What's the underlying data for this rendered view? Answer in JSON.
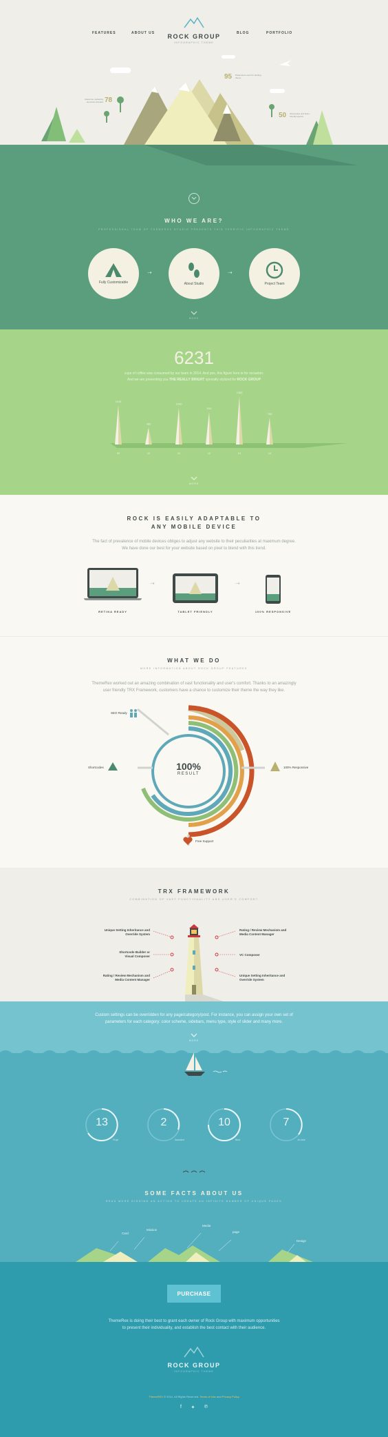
{
  "brand": {
    "name": "ROCK GROUP",
    "tagline": "INFOGRAPHIC THEME"
  },
  "nav": {
    "items": [
      "FEATURES",
      "ABOUT US",
      "BLOG",
      "PORTFOLIO"
    ]
  },
  "hero": {
    "stats": [
      {
        "value": "95",
        "text": "Parameters used for landing theme"
      },
      {
        "value": "78",
        "text": "Awesome marketing elements included"
      },
      {
        "value": "50",
        "text": "Shortcodes and brain-friendly layouts"
      }
    ]
  },
  "who": {
    "title": "WHO WE ARE?",
    "subtitle": "PROFESSIONAL TEAM OF THEMEREX STUDIO PRESENTS THIS TERRIFIC INFOGRAPHIC THEME",
    "items": [
      {
        "label": "Fully Customizable",
        "icon": "tent-icon"
      },
      {
        "label": "About Studio",
        "icon": "footprints-icon"
      },
      {
        "label": "Project Team",
        "icon": "clock-icon"
      }
    ],
    "more": "MORE"
  },
  "coffee": {
    "number": "6231",
    "text1": "cups of coffee was consumed by our team in 2014. And yes, this figure here is for occasion.",
    "text2_pre": "And we are presenting you",
    "text2_b1": "THE REALLY BRIGHT",
    "text2_mid": "specially stylized for",
    "text2_b2": "ROCK GROUP",
    "more": "MORE"
  },
  "chart_data": {
    "type": "bar",
    "categories": [
      "09",
      "10",
      "11",
      "12",
      "13",
      "14"
    ],
    "values": [
      1105,
      480,
      1040,
      910,
      1360,
      760
    ],
    "value_labels": [
      "1105",
      "480",
      "1040",
      "910",
      "1360",
      "760"
    ]
  },
  "adaptable": {
    "title1": "ROCK IS EASILY ADAPTABLE TO",
    "title2": "ANY MOBILE DEVICE",
    "text1": "The fact of prevalence of mobile devices obliges to adjust any website to their peculiarities at maximum degree.",
    "text2": "We have done our best for your website based on pixel to blend with this trend.",
    "devices": [
      "RETINA READY",
      "TABLET FRIENDLY",
      "100% RESPONSIVE"
    ]
  },
  "whatwedo": {
    "title": "WHAT WE DO",
    "subtitle": "MORE INFORMATION ABOUT ROCK GROUP FEATURES",
    "text1": "ThemeRex worked out an amazing combination of vast functionality and user's comfort. Thanks to an amazingly",
    "text2": "user friendly TRX Framework, customers have a chance to customize their theme the way they like.",
    "center_value": "100%",
    "center_label": "RESULT",
    "legend": [
      "SEO Ready",
      "Shortcodes",
      "100% Responsive",
      "Free Support"
    ],
    "ring_colors": [
      "#c9542a",
      "#e2a04a",
      "#8fbf76",
      "#5fa8b8",
      "#cfc89c"
    ]
  },
  "trx": {
    "title": "TRX FRAMEWORK",
    "subtitle": "COMBINATION OF VAST FUNCTIONALITY AND USER'S COMFORT",
    "left": [
      "Unique Setting Inheritance and Override System",
      "Shortcode Builder or Visual Composer",
      "Rating / Review Mechanism and Media Content Manager"
    ],
    "right": [
      "Rating / Review Mechanism and Media Content Manager",
      "VC Composer",
      "Unique Setting Inheritance and Override System"
    ]
  },
  "sea": {
    "text1": "Custom settings can be overridden for any page/category/post. For instance, you can assign your own set of",
    "text2": "parameters for each category: color scheme, sidebars, menu type, style of slider and many more.",
    "more": "MORE",
    "stats": [
      {
        "value": "13",
        "label": "Proje"
      },
      {
        "value": "2",
        "label": "Awarded"
      },
      {
        "value": "10",
        "label": "Best"
      },
      {
        "value": "7",
        "label": "Jer test"
      }
    ],
    "facts_title": "SOME FACTS ABOUT US",
    "facts_subtitle": "READ MORE DIGGING AN ACTION TO CREATE AN INFINITE NUMBER OF UNIQUE PAGES",
    "islands": [
      "Card",
      "Mission",
      "Media",
      "page",
      "Design"
    ]
  },
  "footer": {
    "purchase": "PURCHASE",
    "text1": "ThemeRex is doing their best to grant each owner of Rock Group with maximum opportunities",
    "text2": "to present their individuality, and establish the best contact with their audience.",
    "copyright_pre": "ThemeREX",
    "copyright_mid": "© 2014. All Rights Reserved.",
    "terms": "Terms of Use",
    "and": "and",
    "privacy": "Privacy Policy",
    "social": [
      "facebook-icon",
      "twitter-icon",
      "pinterest-icon"
    ]
  },
  "colors": {
    "green": "#5a9e7d",
    "lime": "#a6d58a",
    "cream": "#f9f8f3",
    "teal": "#2f9cad",
    "sea": "#5bb3c6",
    "accent": "#d0353e"
  }
}
